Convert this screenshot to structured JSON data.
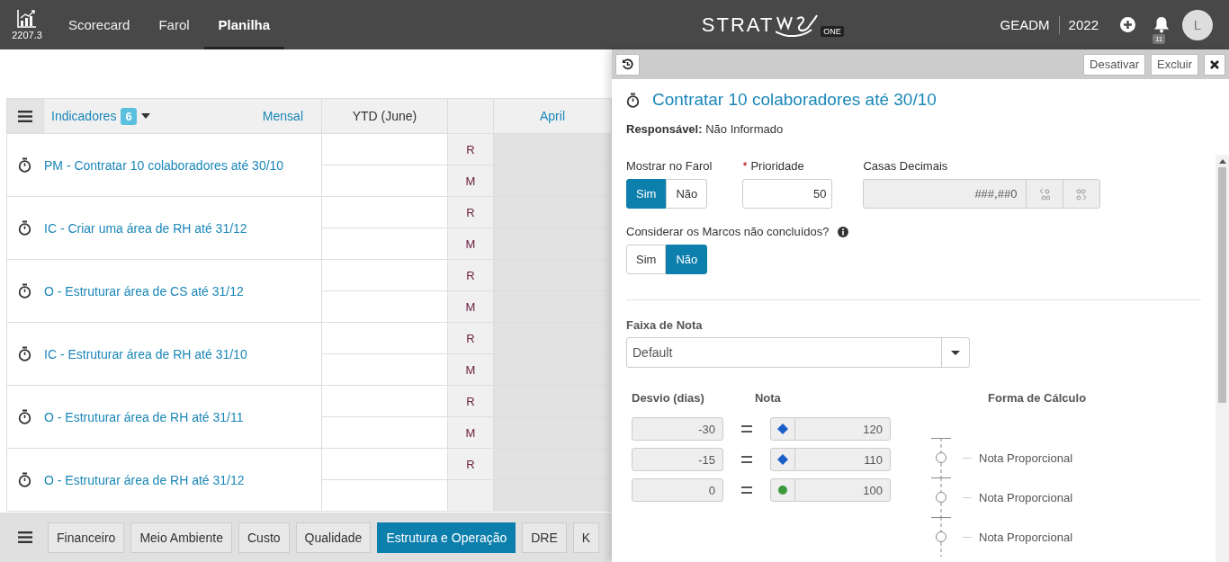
{
  "header": {
    "version": "2207.3",
    "nav": [
      {
        "label": "Scorecard",
        "selected": false
      },
      {
        "label": "Farol",
        "selected": false
      },
      {
        "label": "Planilha",
        "selected": true
      }
    ],
    "logo": {
      "text": "STRAT",
      "badge": "ONE"
    },
    "org": "GEADM",
    "year": "2022",
    "notifications": "11",
    "avatar": "L"
  },
  "table": {
    "indicators_label": "Indicadores",
    "indicators_count": "6",
    "period": "Mensal",
    "columns": [
      "YTD (June)",
      "April"
    ],
    "rows": [
      {
        "name": "PM - Contratar 10 colaboradores até 30/10",
        "lines": [
          "R",
          "M"
        ]
      },
      {
        "name": "IC - Criar uma área de RH até 31/12",
        "lines": [
          "R",
          "M"
        ]
      },
      {
        "name": "O - Estruturar área de CS até 31/12",
        "lines": [
          "R",
          "M"
        ]
      },
      {
        "name": "IC - Estruturar área de RH até 31/10",
        "lines": [
          "R",
          "M"
        ]
      },
      {
        "name": "O - Estruturar área de RH até 31/11",
        "lines": [
          "R",
          "M"
        ]
      },
      {
        "name": "O - Estruturar área de RH até 31/12",
        "lines": [
          "R"
        ]
      }
    ]
  },
  "bottom_tabs": [
    {
      "label": "Financeiro",
      "selected": false
    },
    {
      "label": "Meio Ambiente",
      "selected": false
    },
    {
      "label": "Custo",
      "selected": false
    },
    {
      "label": "Qualidade",
      "selected": false
    },
    {
      "label": "Estrutura e Operação",
      "selected": true
    },
    {
      "label": "DRE",
      "selected": false
    },
    {
      "label": "K",
      "selected": false
    }
  ],
  "panel": {
    "buttons": [
      "Desativar",
      "Excluir"
    ],
    "title": "Contratar 10 colaboradores até 30/10",
    "responsible_label": "Responsável:",
    "responsible_value": "Não Informado",
    "show_in_farol": {
      "label": "Mostrar no Farol",
      "options": [
        {
          "label": "Sim",
          "selected": true
        },
        {
          "label": "Não",
          "selected": false
        }
      ]
    },
    "priority": {
      "required_mark": "*",
      "label": "Prioridade",
      "value": "50"
    },
    "decimals": {
      "label": "Casas Decimais",
      "value": "###,##0"
    },
    "consider": {
      "label": "Considerar os Marcos não concluídos?",
      "options": [
        {
          "label": "Sim",
          "selected": false
        },
        {
          "label": "Não",
          "selected": true
        }
      ]
    },
    "grade_range": {
      "label": "Faixa de Nota",
      "value": "Default"
    },
    "grade_table": {
      "columns": [
        "Desvio (dias)",
        "Nota",
        "Forma de Cálculo"
      ],
      "rows": [
        {
          "deviation": "-30",
          "grade": "120",
          "kind": "diamond",
          "color": "#1a5fc8"
        },
        {
          "deviation": "-15",
          "grade": "110",
          "kind": "diamond",
          "color": "#1a5fc8"
        },
        {
          "deviation": "0",
          "grade": "100",
          "kind": "dot",
          "color": "#3c9a3c"
        }
      ],
      "methods": [
        "Nota Proporcional",
        "Nota Proporcional",
        "Nota Proporcional"
      ]
    }
  }
}
